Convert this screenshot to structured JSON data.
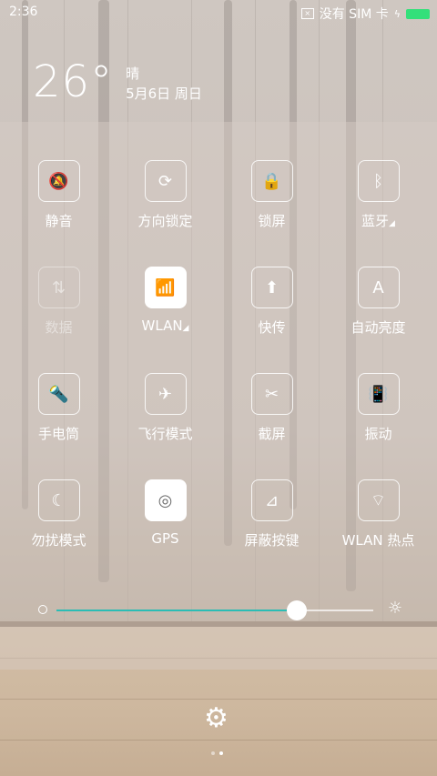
{
  "status": {
    "time": "2:36",
    "no_signal": "没有 SIM 卡"
  },
  "weather": {
    "temp": "26°",
    "condition": "晴",
    "date": "5月6日 周日"
  },
  "tiles": [
    {
      "label": "静音",
      "icon": "bell-off-icon",
      "glyph": "🔕",
      "state": "off"
    },
    {
      "label": "方向锁定",
      "icon": "rotation-lock-icon",
      "glyph": "⟳",
      "state": "off"
    },
    {
      "label": "锁屏",
      "icon": "lock-icon",
      "glyph": "🔒",
      "state": "off"
    },
    {
      "label": "蓝牙",
      "icon": "bluetooth-icon",
      "glyph": "ᛒ",
      "state": "off",
      "expand": "◢"
    },
    {
      "label": "数据",
      "icon": "data-icon",
      "glyph": "⇅",
      "state": "disabled"
    },
    {
      "label": "WLAN",
      "icon": "wifi-icon",
      "glyph": "📶",
      "state": "on",
      "expand": "◢"
    },
    {
      "label": "快传",
      "icon": "share-icon",
      "glyph": "⬆",
      "state": "off"
    },
    {
      "label": "自动亮度",
      "icon": "auto-brightness-icon",
      "glyph": "A",
      "state": "off"
    },
    {
      "label": "手电筒",
      "icon": "flashlight-icon",
      "glyph": "🔦",
      "state": "off"
    },
    {
      "label": "飞行模式",
      "icon": "airplane-icon",
      "glyph": "✈",
      "state": "off"
    },
    {
      "label": "截屏",
      "icon": "screenshot-icon",
      "glyph": "✂",
      "state": "off"
    },
    {
      "label": "振动",
      "icon": "vibrate-icon",
      "glyph": "📳",
      "state": "off"
    },
    {
      "label": "勿扰模式",
      "icon": "moon-icon",
      "glyph": "☾",
      "state": "off"
    },
    {
      "label": "GPS",
      "icon": "gps-icon",
      "glyph": "◎",
      "state": "on"
    },
    {
      "label": "屏蔽按键",
      "icon": "block-keys-icon",
      "glyph": "⊿",
      "state": "off"
    },
    {
      "label": "WLAN 热点",
      "icon": "hotspot-icon",
      "glyph": "⌔",
      "state": "off"
    }
  ],
  "brightness": {
    "value": 0.76
  },
  "pager": {
    "pages": 2,
    "current": 1
  },
  "colors": {
    "accent": "#2bbdb5",
    "battery": "#33e07a"
  }
}
